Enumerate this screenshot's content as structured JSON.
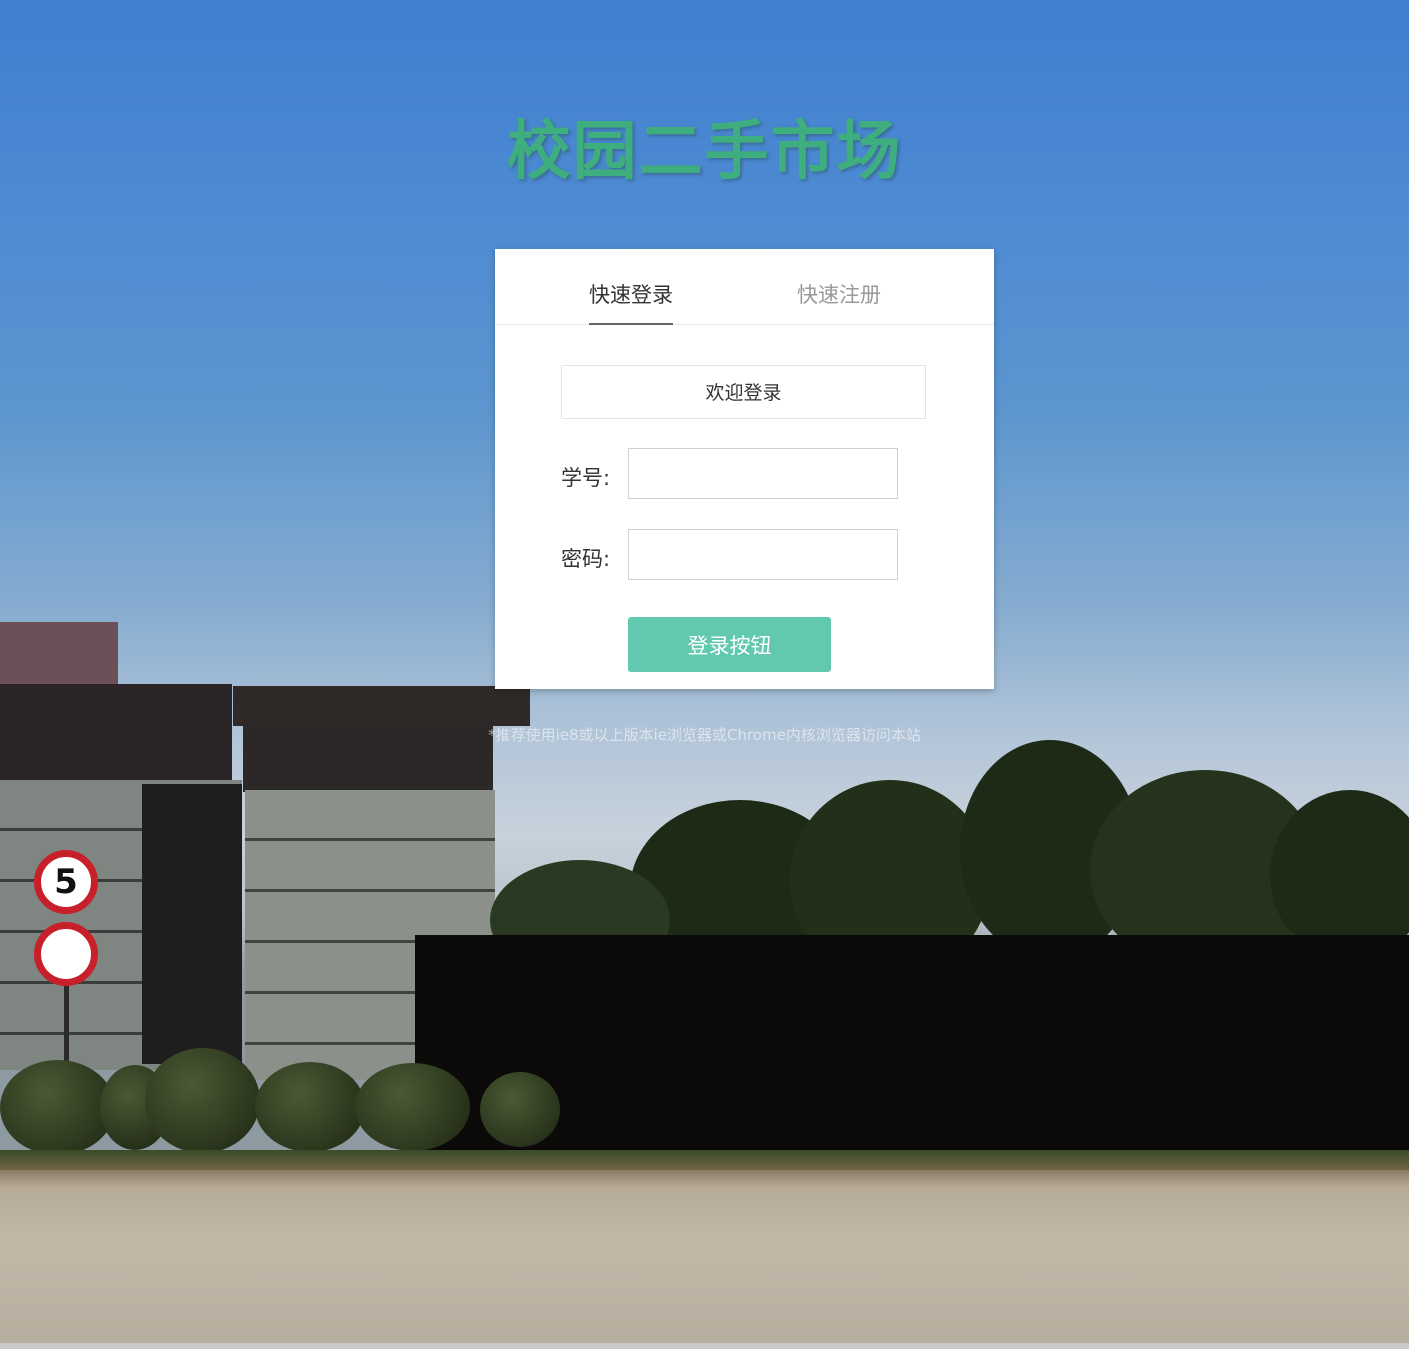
{
  "site": {
    "title": "校园二手市场"
  },
  "tabs": [
    {
      "label": "快速登录",
      "active": true
    },
    {
      "label": "快速注册",
      "active": false
    }
  ],
  "login_form": {
    "welcome": "欢迎登录",
    "student_id_label": "学号:",
    "student_id_value": "",
    "password_label": "密码:",
    "password_value": "",
    "submit_label": "登录按钮"
  },
  "hint": "*推荐使用ie8或以上版本ie浏览器或Chrome内核浏览器访问本站",
  "colors": {
    "title": "#3fae7f",
    "button": "#62c9b0",
    "card": "#ffffff"
  }
}
